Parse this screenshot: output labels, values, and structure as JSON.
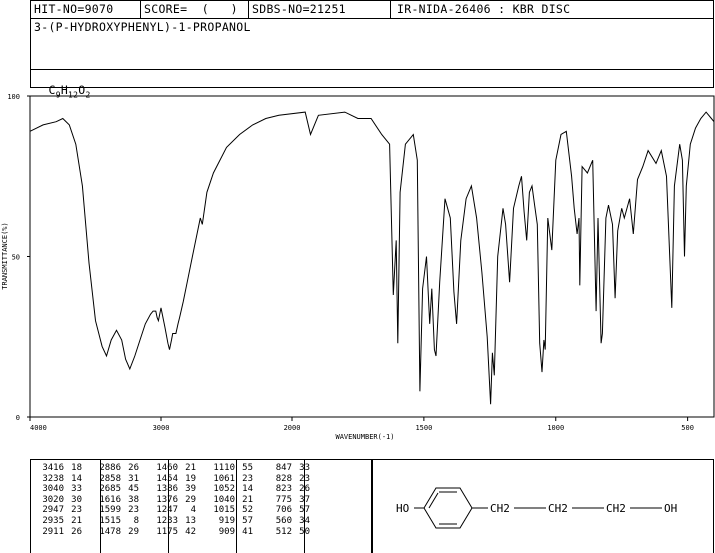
{
  "header": {
    "hit_no": "HIT-NO=9070",
    "score": "SCORE=  (   )",
    "sdbs_no": "SDBS-NO=21251",
    "ir_info": "IR-NIDA-26406 : KBR DISC"
  },
  "compound_name": "3-(P-HYDROXYPHENYL)-1-PROPANOL",
  "formula": {
    "main": "C9H12O2",
    "parts": [
      "C",
      "9",
      "H",
      "12",
      "O",
      "2"
    ]
  },
  "chart_data": {
    "type": "line",
    "xlabel": "WAVENUMBER(-1)",
    "ylabel": "TRANSMITTANCE(%)",
    "xlim": [
      4000,
      400
    ],
    "ylim": [
      0,
      100
    ],
    "x_ticks": [
      4000,
      3000,
      2000,
      1500,
      1000,
      500
    ],
    "x_tick_labels": [
      "4000",
      "3000",
      "2000",
      "1500",
      "1000",
      "500"
    ],
    "y_ticks": [
      0,
      50,
      100
    ],
    "y_tick_labels": [
      "0",
      "50",
      "100"
    ],
    "series": [
      {
        "points": [
          [
            4000,
            89
          ],
          [
            3900,
            91
          ],
          [
            3800,
            92
          ],
          [
            3750,
            93
          ],
          [
            3700,
            91
          ],
          [
            3650,
            85
          ],
          [
            3600,
            72
          ],
          [
            3550,
            48
          ],
          [
            3500,
            30
          ],
          [
            3450,
            22
          ],
          [
            3416,
            19
          ],
          [
            3380,
            24
          ],
          [
            3340,
            27
          ],
          [
            3300,
            24
          ],
          [
            3270,
            18
          ],
          [
            3238,
            15
          ],
          [
            3200,
            19
          ],
          [
            3160,
            24
          ],
          [
            3120,
            29
          ],
          [
            3080,
            32
          ],
          [
            3060,
            33
          ],
          [
            3040,
            33
          ],
          [
            3030,
            31
          ],
          [
            3020,
            30
          ],
          [
            3000,
            34
          ],
          [
            2970,
            28
          ],
          [
            2947,
            23
          ],
          [
            2935,
            21
          ],
          [
            2920,
            24
          ],
          [
            2911,
            26
          ],
          [
            2886,
            26
          ],
          [
            2870,
            29
          ],
          [
            2858,
            31
          ],
          [
            2830,
            36
          ],
          [
            2800,
            42
          ],
          [
            2760,
            50
          ],
          [
            2700,
            62
          ],
          [
            2685,
            60
          ],
          [
            2650,
            70
          ],
          [
            2600,
            76
          ],
          [
            2500,
            84
          ],
          [
            2400,
            88
          ],
          [
            2300,
            91
          ],
          [
            2200,
            93
          ],
          [
            2100,
            94
          ],
          [
            1950,
            95
          ],
          [
            1930,
            88
          ],
          [
            1900,
            94
          ],
          [
            1800,
            95
          ],
          [
            1750,
            93
          ],
          [
            1700,
            93
          ],
          [
            1660,
            88
          ],
          [
            1630,
            85
          ],
          [
            1616,
            38
          ],
          [
            1605,
            55
          ],
          [
            1599,
            23
          ],
          [
            1590,
            70
          ],
          [
            1570,
            85
          ],
          [
            1540,
            88
          ],
          [
            1525,
            80
          ],
          [
            1515,
            8
          ],
          [
            1505,
            40
          ],
          [
            1490,
            50
          ],
          [
            1478,
            29
          ],
          [
            1470,
            40
          ],
          [
            1460,
            21
          ],
          [
            1454,
            19
          ],
          [
            1440,
            42
          ],
          [
            1420,
            68
          ],
          [
            1400,
            62
          ],
          [
            1386,
            39
          ],
          [
            1376,
            29
          ],
          [
            1360,
            55
          ],
          [
            1340,
            68
          ],
          [
            1320,
            72
          ],
          [
            1300,
            62
          ],
          [
            1280,
            45
          ],
          [
            1260,
            25
          ],
          [
            1247,
            4
          ],
          [
            1240,
            20
          ],
          [
            1233,
            13
          ],
          [
            1220,
            50
          ],
          [
            1200,
            65
          ],
          [
            1190,
            60
          ],
          [
            1175,
            42
          ],
          [
            1160,
            65
          ],
          [
            1140,
            72
          ],
          [
            1130,
            75
          ],
          [
            1120,
            64
          ],
          [
            1110,
            55
          ],
          [
            1100,
            70
          ],
          [
            1090,
            72
          ],
          [
            1080,
            66
          ],
          [
            1070,
            60
          ],
          [
            1061,
            23
          ],
          [
            1052,
            14
          ],
          [
            1045,
            24
          ],
          [
            1040,
            21
          ],
          [
            1030,
            62
          ],
          [
            1015,
            52
          ],
          [
            1000,
            80
          ],
          [
            980,
            88
          ],
          [
            960,
            89
          ],
          [
            940,
            75
          ],
          [
            930,
            65
          ],
          [
            919,
            57
          ],
          [
            912,
            62
          ],
          [
            909,
            41
          ],
          [
            900,
            78
          ],
          [
            880,
            76
          ],
          [
            860,
            80
          ],
          [
            847,
            33
          ],
          [
            840,
            62
          ],
          [
            828,
            23
          ],
          [
            823,
            26
          ],
          [
            810,
            62
          ],
          [
            800,
            66
          ],
          [
            785,
            60
          ],
          [
            775,
            37
          ],
          [
            765,
            58
          ],
          [
            750,
            65
          ],
          [
            740,
            62
          ],
          [
            720,
            68
          ],
          [
            706,
            57
          ],
          [
            690,
            74
          ],
          [
            670,
            78
          ],
          [
            650,
            83
          ],
          [
            620,
            79
          ],
          [
            600,
            83
          ],
          [
            580,
            75
          ],
          [
            560,
            34
          ],
          [
            550,
            72
          ],
          [
            530,
            85
          ],
          [
            520,
            80
          ],
          [
            512,
            50
          ],
          [
            505,
            72
          ],
          [
            490,
            85
          ],
          [
            470,
            90
          ],
          [
            450,
            93
          ],
          [
            430,
            95
          ],
          [
            410,
            93
          ],
          [
            400,
            92
          ]
        ]
      }
    ],
    "peak_table": [
      [
        "3416",
        "18",
        "2886",
        "26",
        "1460",
        "21",
        "1110",
        "55",
        "847",
        "33"
      ],
      [
        "3238",
        "14",
        "2858",
        "31",
        "1454",
        "19",
        "1061",
        "23",
        "828",
        "23"
      ],
      [
        "3040",
        "33",
        "2685",
        "45",
        "1386",
        "39",
        "1052",
        "14",
        "823",
        "26"
      ],
      [
        "3020",
        "30",
        "1616",
        "38",
        "1376",
        "29",
        "1040",
        "21",
        "775",
        "37"
      ],
      [
        "2947",
        "23",
        "1599",
        "23",
        "1247",
        "4",
        "1015",
        "52",
        "706",
        "57"
      ],
      [
        "2935",
        "21",
        "1515",
        "8",
        "1233",
        "13",
        "919",
        "57",
        "560",
        "34"
      ],
      [
        "2911",
        "26",
        "1478",
        "29",
        "1175",
        "42",
        "909",
        "41",
        "512",
        "50"
      ]
    ]
  },
  "structure": {
    "left_label": "HO",
    "chain": [
      "CH2",
      "CH2",
      "CH2"
    ],
    "right_label": "OH"
  },
  "colors": {
    "ink": "#000000",
    "background": "#ffffff"
  }
}
